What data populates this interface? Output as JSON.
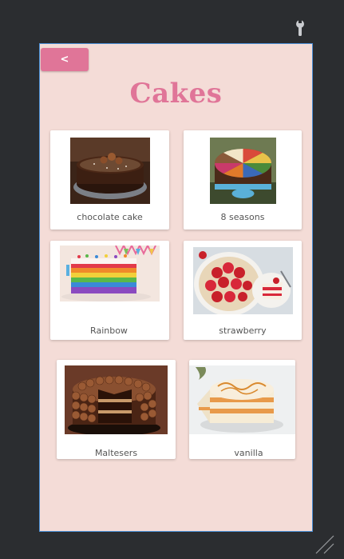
{
  "app": {
    "back_label": "<",
    "title": "Cakes"
  },
  "cakes": [
    {
      "name": "chocolate cake"
    },
    {
      "name": "8 seasons"
    },
    {
      "name": "Rainbow"
    },
    {
      "name": "strawberry"
    },
    {
      "name": "Maltesers"
    },
    {
      "name": "vanilla"
    }
  ],
  "colors": {
    "background": "#2b2d30",
    "screen": "#f4dcd7",
    "accent": "#e07598",
    "card": "#ffffff",
    "label_text": "#555555",
    "frame_border": "#4b8fd6"
  }
}
